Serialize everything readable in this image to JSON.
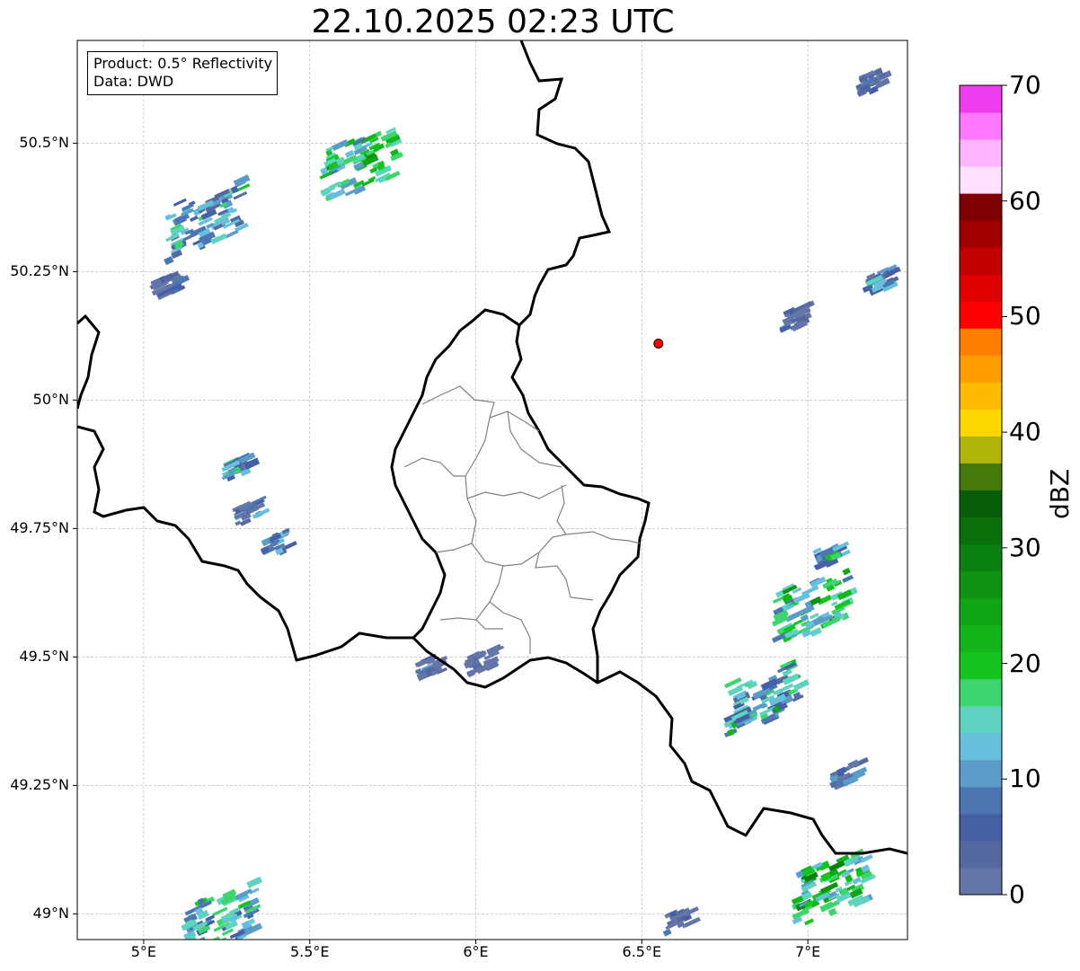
{
  "title": "22.10.2025 02:23 UTC",
  "info_box": {
    "product_line": "Product: 0.5° Reflectivity",
    "data_line": "Data: DWD"
  },
  "map": {
    "lon_range": [
      4.8,
      7.3
    ],
    "lat_range": [
      48.95,
      50.7
    ],
    "lat_ticks": [
      {
        "value": 50.5,
        "label": "50.5°N"
      },
      {
        "value": 50.25,
        "label": "50.25°N"
      },
      {
        "value": 50.0,
        "label": "50°N"
      },
      {
        "value": 49.75,
        "label": "49.75°N"
      },
      {
        "value": 49.5,
        "label": "49.5°N"
      },
      {
        "value": 49.25,
        "label": "49.25°N"
      },
      {
        "value": 49.0,
        "label": "49°N"
      }
    ],
    "lon_ticks": [
      {
        "value": 5.0,
        "label": "5°E"
      },
      {
        "value": 5.5,
        "label": "5.5°E"
      },
      {
        "value": 6.0,
        "label": "6°E"
      },
      {
        "value": 6.5,
        "label": "6.5°E"
      },
      {
        "value": 7.0,
        "label": "7°E"
      }
    ],
    "grid": true,
    "radar_site": {
      "lon": 6.55,
      "lat": 50.11,
      "color": "#ff0000"
    },
    "precip_cells": [
      {
        "lon": 5.64,
        "lat": 50.46,
        "dbz": 22
      },
      {
        "lon": 5.17,
        "lat": 50.35,
        "dbz": 16
      },
      {
        "lon": 5.05,
        "lat": 50.22,
        "dbz": 8
      },
      {
        "lon": 5.27,
        "lat": 49.87,
        "dbz": 14
      },
      {
        "lon": 5.3,
        "lat": 49.78,
        "dbz": 8
      },
      {
        "lon": 5.38,
        "lat": 49.72,
        "dbz": 14
      },
      {
        "lon": 5.85,
        "lat": 49.48,
        "dbz": 8
      },
      {
        "lon": 6.0,
        "lat": 49.49,
        "dbz": 6
      },
      {
        "lon": 7.18,
        "lat": 50.62,
        "dbz": 8
      },
      {
        "lon": 7.2,
        "lat": 50.23,
        "dbz": 14
      },
      {
        "lon": 6.95,
        "lat": 50.16,
        "dbz": 6
      },
      {
        "lon": 7.05,
        "lat": 49.7,
        "dbz": 14
      },
      {
        "lon": 7.0,
        "lat": 49.6,
        "dbz": 22
      },
      {
        "lon": 6.85,
        "lat": 49.42,
        "dbz": 18
      },
      {
        "lon": 7.1,
        "lat": 49.27,
        "dbz": 12
      },
      {
        "lon": 7.05,
        "lat": 49.05,
        "dbz": 24
      },
      {
        "lon": 6.6,
        "lat": 48.99,
        "dbz": 6
      },
      {
        "lon": 5.22,
        "lat": 48.99,
        "dbz": 18
      }
    ]
  },
  "colorbar": {
    "label": "dBZ",
    "min": 0,
    "max": 70,
    "tick_labels": [
      "0",
      "10",
      "20",
      "30",
      "40",
      "50",
      "60",
      "70"
    ],
    "colors": [
      "#6475a8",
      "#5569a0",
      "#4560a5",
      "#4c76b2",
      "#5a9cc8",
      "#66c0dc",
      "#5ed4c0",
      "#3ed46e",
      "#13c51d",
      "#12b61a",
      "#10a615",
      "#0e9412",
      "#0b820f",
      "#0a700b",
      "#085d08",
      "#467a0b",
      "#afb40a",
      "#ffd700",
      "#ffb900",
      "#ff9d00",
      "#ff7d00",
      "#ff0000",
      "#e00000",
      "#c20000",
      "#a20000",
      "#7f0000",
      "#ffe0ff",
      "#ffb4ff",
      "#ff78ff",
      "#ee3cee"
    ]
  }
}
